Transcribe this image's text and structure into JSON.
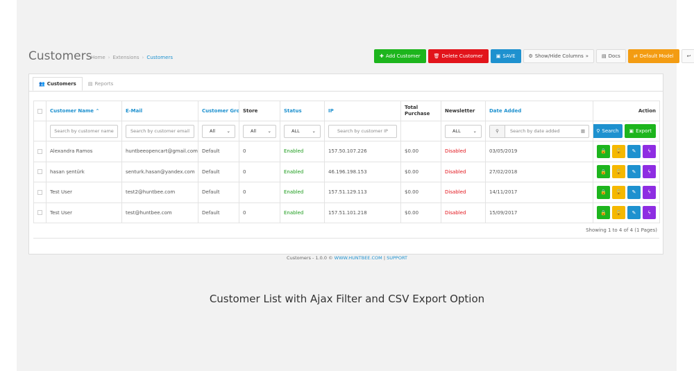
{
  "header": {
    "title": "Customers",
    "breadcrumb": [
      "Home",
      "Extensions",
      "Customers"
    ]
  },
  "toolbar": {
    "add": "Add Customer",
    "delete": "Delete Customer",
    "save": "SAVE",
    "columns": "Show/Hide Columns",
    "docs": "Docs",
    "model": "Default Model"
  },
  "tabs": [
    "Customers",
    "Reports"
  ],
  "table": {
    "columns": [
      "Customer Name",
      "E-Mail",
      "Customer Group",
      "Store",
      "Status",
      "IP",
      "Total Purchase",
      "Newsletter",
      "Date Added",
      "Action"
    ],
    "filters": {
      "name_placeholder": "Search by customer name",
      "email_placeholder": "Search by customer email",
      "group": "All",
      "store": "All",
      "status": "ALL",
      "ip_placeholder": "Search by customer IP",
      "newsletter": "ALL",
      "date_placeholder": "Search by date added",
      "search": "Search",
      "export": "Export"
    },
    "rows": [
      {
        "name": "Alexandra Ramos",
        "email": "huntbeeopencart@gmail.com",
        "group": "Default",
        "store": "0",
        "status": "Enabled",
        "ip": "157.50.107.226",
        "total": "$0.00",
        "newsletter": "Disabled",
        "date": "03/05/2019"
      },
      {
        "name": "hasan şentürk",
        "email": "senturk.hasan@yandex.com",
        "group": "Default",
        "store": "0",
        "status": "Enabled",
        "ip": "46.196.198.153",
        "total": "$0.00",
        "newsletter": "Disabled",
        "date": "27/02/2018"
      },
      {
        "name": "Test User",
        "email": "test2@huntbee.com",
        "group": "Default",
        "store": "0",
        "status": "Enabled",
        "ip": "157.51.129.113",
        "total": "$0.00",
        "newsletter": "Disabled",
        "date": "14/11/2017"
      },
      {
        "name": "Test User",
        "email": "test@huntbee.com",
        "group": "Default",
        "store": "0",
        "status": "Enabled",
        "ip": "157.51.101.218",
        "total": "$0.00",
        "newsletter": "Disabled",
        "date": "15/09/2017"
      }
    ],
    "showing": "Showing 1 to 4 of 4 (1 Pages)"
  },
  "footer": {
    "text": "Customers - 1.0.0 ©",
    "link1": "WWW.HUNTBEE.COM",
    "sep": "|",
    "link2": "SUPPORT"
  },
  "caption": "Customer List with Ajax Filter and CSV Export Option",
  "colors": {
    "green": "#1db51d",
    "red": "#e2141b",
    "blue": "#1e91cf",
    "orange": "#f39c12",
    "yellow": "#f5b800",
    "purple": "#8e2de2"
  }
}
